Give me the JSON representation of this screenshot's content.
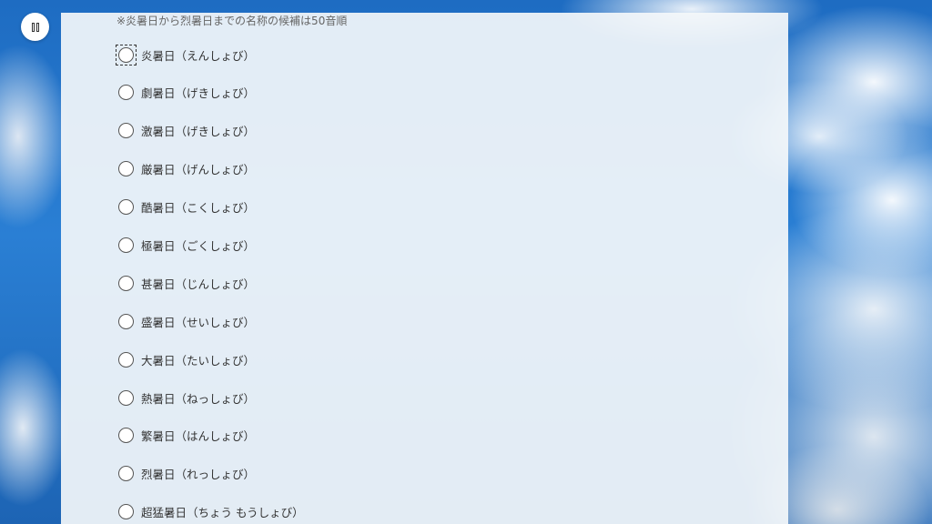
{
  "note": "※炎暑日から烈暑日までの名称の候補は50音順",
  "pause_button": {
    "icon": "pause-icon"
  },
  "options": [
    {
      "label": "炎暑日（えんしょび）",
      "focused": true
    },
    {
      "label": "劇暑日（げきしょび）"
    },
    {
      "label": "激暑日（げきしょび）"
    },
    {
      "label": "厳暑日（げんしょび）"
    },
    {
      "label": "酷暑日（こくしょび）"
    },
    {
      "label": "極暑日（ごくしょび）"
    },
    {
      "label": "甚暑日（じんしょび）"
    },
    {
      "label": "盛暑日（せいしょび）"
    },
    {
      "label": "大暑日（たいしょび）"
    },
    {
      "label": "熱暑日（ねっしょび）"
    },
    {
      "label": "繁暑日（はんしょび）"
    },
    {
      "label": "烈暑日（れっしょび）"
    },
    {
      "label": "超猛暑日（ちょう もうしょび）"
    }
  ]
}
